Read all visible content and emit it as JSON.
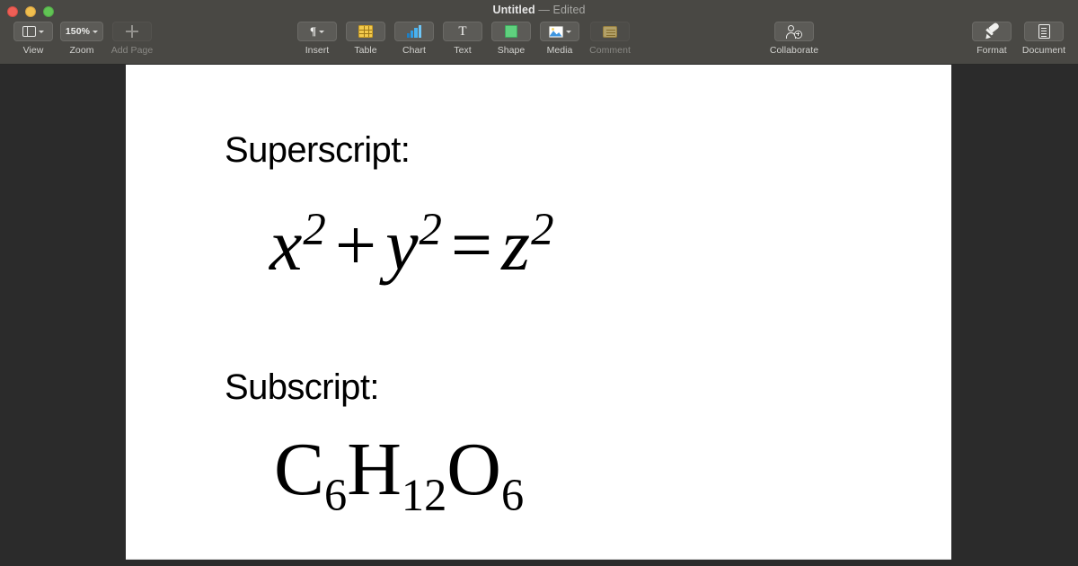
{
  "window": {
    "title": "Untitled",
    "status": "— Edited",
    "traffic_lights": [
      {
        "name": "close",
        "color": "#ef5f56"
      },
      {
        "name": "minimize",
        "color": "#f0bf4e"
      },
      {
        "name": "zoom",
        "color": "#61c454"
      }
    ],
    "chrome_color": "#494844",
    "canvas_color": "#2b2b2b"
  },
  "toolbar": {
    "left_group": [
      {
        "label": "View",
        "icon": "sidebar-layout-icon",
        "has_chevron": true,
        "enabled": true
      },
      {
        "label": "Zoom",
        "icon": "zoom-value",
        "value": "150%",
        "has_chevron": true,
        "enabled": true
      },
      {
        "label": "Add Page",
        "icon": "plus-icon",
        "has_chevron": false,
        "enabled": false
      }
    ],
    "center_group": [
      {
        "label": "Insert",
        "icon": "pilcrow-icon",
        "glyph": "¶",
        "has_chevron": true,
        "enabled": true
      },
      {
        "label": "Table",
        "icon": "table-grid-icon",
        "has_chevron": false,
        "enabled": true
      },
      {
        "label": "Chart",
        "icon": "bar-chart-icon",
        "has_chevron": false,
        "enabled": true
      },
      {
        "label": "Text",
        "icon": "text-t-icon",
        "glyph": "T",
        "has_chevron": false,
        "enabled": true
      },
      {
        "label": "Shape",
        "icon": "shape-square-icon",
        "has_chevron": false,
        "enabled": true
      },
      {
        "label": "Media",
        "icon": "photo-icon",
        "has_chevron": true,
        "enabled": true
      },
      {
        "label": "Comment",
        "icon": "comment-note-icon",
        "has_chevron": false,
        "enabled": false
      }
    ],
    "collaborate_group": [
      {
        "label": "Collaborate",
        "icon": "person-add-icon",
        "has_chevron": false,
        "enabled": true
      }
    ],
    "right_group": [
      {
        "label": "Format",
        "icon": "paintbrush-icon",
        "has_chevron": false,
        "enabled": true
      },
      {
        "label": "Document",
        "icon": "document-icon",
        "has_chevron": false,
        "enabled": true
      }
    ]
  },
  "document": {
    "page_background": "#ffffff",
    "sections": [
      {
        "heading": "Superscript:",
        "content_kind": "equation",
        "content_plain": "x2 + y2 = z2",
        "parts": {
          "base1": "x",
          "exp1": "2",
          "operator": "+",
          "base2": "y",
          "exp2": "2",
          "equals": "=",
          "base3": "z",
          "exp3": "2"
        }
      },
      {
        "heading": "Subscript:",
        "content_kind": "chemical-formula",
        "content_plain": "C6H12O6",
        "parts": {
          "el1": "C",
          "sub1": "6",
          "el2": "H",
          "sub2": "12",
          "el3": "O",
          "sub3": "6"
        }
      }
    ]
  }
}
